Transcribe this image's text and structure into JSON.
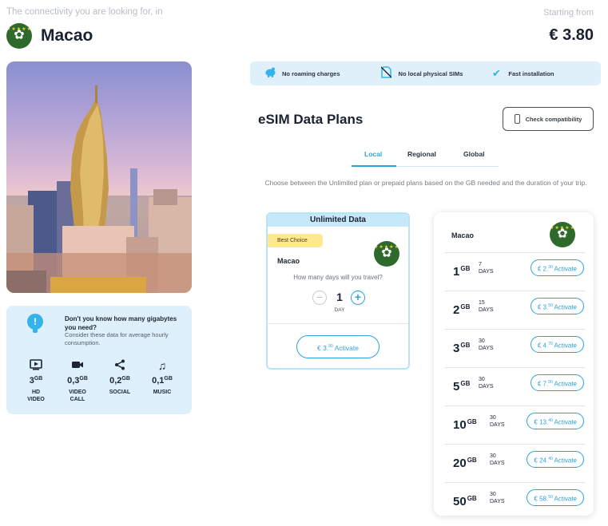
{
  "header": {
    "tagline": "The connectivity you are looking for, in",
    "country": "Macao",
    "starting_label": "Starting from",
    "starting_price": "€ 3.80"
  },
  "tips": {
    "question": "Don't you know how many gigabytes you need?",
    "subtitle": "Consider these data for average hourly consumption.",
    "usage": [
      {
        "icon": "play-icon",
        "amount": "3",
        "unit": "GB",
        "label": "HD VIDEO"
      },
      {
        "icon": "video-call-icon",
        "amount": "0,3",
        "unit": "GB",
        "label": "VIDEO CALL"
      },
      {
        "icon": "share-icon",
        "amount": "0,2",
        "unit": "GB",
        "label": "SOCIAL"
      },
      {
        "icon": "music-icon",
        "amount": "0,1",
        "unit": "GB",
        "label": "MUSIC"
      }
    ]
  },
  "features": [
    {
      "icon": "piggy-bank-icon",
      "label": "No roaming charges"
    },
    {
      "icon": "no-sim-icon",
      "label": "No local physical SIMs"
    },
    {
      "icon": "checkmark-icon",
      "label": "Fast installation"
    }
  ],
  "plans_title": "eSIM Data Plans",
  "compat_button": "Check compatibility",
  "tabs": [
    "Local",
    "Regional",
    "Global"
  ],
  "active_tab": "Local",
  "description": "Choose between the Unlimited plan or prepaid plans based on the GB needed and the duration of your trip.",
  "unlimited": {
    "title": "Unlimited Data",
    "badge": "Best Choice",
    "country": "Macao",
    "days_question": "How many days will you travel?",
    "days_value": "1",
    "days_unit": "DAY",
    "price_main": "€ 3.",
    "price_cents": "80",
    "activate_label": "Activate"
  },
  "plan_list": {
    "country": "Macao",
    "plans": [
      {
        "gb": "1",
        "days": "7",
        "price_main": "€ 2.",
        "price_cents": "30"
      },
      {
        "gb": "2",
        "days": "15",
        "price_main": "€ 3.",
        "price_cents": "50"
      },
      {
        "gb": "3",
        "days": "30",
        "price_main": "€ 4.",
        "price_cents": "70"
      },
      {
        "gb": "5",
        "days": "30",
        "price_main": "€ 7.",
        "price_cents": "00"
      },
      {
        "gb": "10",
        "days": "30",
        "price_main": "€ 13.",
        "price_cents": "40"
      },
      {
        "gb": "20",
        "days": "30",
        "price_main": "€ 24.",
        "price_cents": "40"
      },
      {
        "gb": "50",
        "days": "30",
        "price_main": "€ 58.",
        "price_cents": "50"
      }
    ],
    "gb_unit": "GB",
    "days_unit": "DAYS",
    "activate_label": "Activate"
  }
}
